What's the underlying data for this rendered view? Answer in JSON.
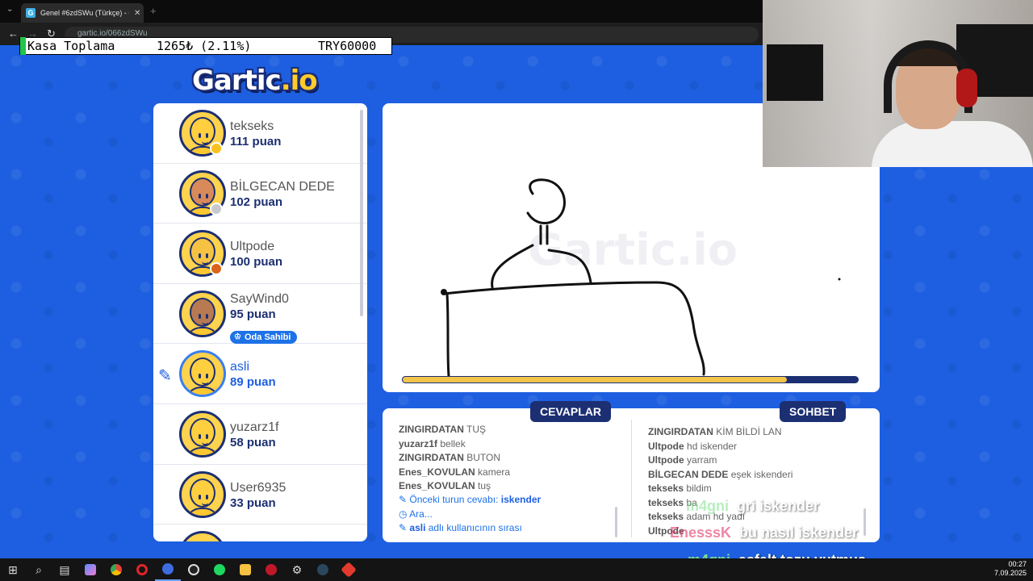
{
  "browser": {
    "tab_title": "Genel #6zdSWu (Türkçe) - Gartic",
    "tab_favicon": "G",
    "url": "gartic.io/066zdSWu"
  },
  "ticker": {
    "label": "Kasa Toplama",
    "amount": "1265₺ (2.11%)",
    "goal": "TRY60000"
  },
  "logo": {
    "main": "Gartic",
    "suffix": ".io"
  },
  "players": [
    {
      "name": "tekseks",
      "points": "111 puan",
      "dot": "#f7c21f",
      "skin": "#ffcf3f"
    },
    {
      "name": "BİLGECAN DEDE",
      "points": "102 puan",
      "dot": "#c7c9ce",
      "skin": "#d88a5a"
    },
    {
      "name": "Ultpode",
      "points": "100 puan",
      "dot": "#d9641a",
      "skin": "#f5c244"
    },
    {
      "name": "SayWind0",
      "points": "95 puan",
      "host": "Oda Sahibi",
      "skin": "#b87a52"
    },
    {
      "name": "asli",
      "points": "89 puan",
      "active": true,
      "skin": "#ffcf3f"
    },
    {
      "name": "yuzarz1f",
      "points": "58 puan",
      "skin": "#ffcf3f"
    },
    {
      "name": "User6935",
      "points": "33 puan",
      "skin": "#ffcf3f"
    }
  ],
  "canvas": {
    "watermark": "Gartic.io",
    "timer_fraction": 0.845
  },
  "tabs": {
    "answers": "CEVAPLAR",
    "chat": "SOHBET"
  },
  "answers": [
    {
      "user": "ZINGIRDATAN",
      "text": "TUŞ"
    },
    {
      "user": "yuzarz1f",
      "text": "bellek"
    },
    {
      "user": "ZINGIRDATAN",
      "text": "BUTON"
    },
    {
      "user": "Enes_KOVULAN",
      "text": "kamera"
    },
    {
      "user": "Enes_KOVULAN",
      "text": "tuş"
    }
  ],
  "answer_info": [
    {
      "icon": "pencil-icon",
      "prefix": "Önceki turun cevabı:",
      "value": "iskender"
    },
    {
      "icon": "clock-icon",
      "prefix": "Ara...",
      "value": ""
    },
    {
      "icon": "pencil-icon",
      "prefix": "adlı kullanıcının sırası",
      "value": "asli"
    }
  ],
  "chat": [
    {
      "user": "ZINGIRDATAN",
      "text": "KİM BİLDİ LAN"
    },
    {
      "user": "Ultpode",
      "text": "hd iskender"
    },
    {
      "user": "Ultpode",
      "text": "yarram"
    },
    {
      "user": "BİLGECAN DEDE",
      "text": "eşek iskenderi"
    },
    {
      "user": "tekseks",
      "text": "bildim"
    },
    {
      "user": "tekseks",
      "text": "ba"
    },
    {
      "user": "tekseks",
      "text": "adam hd yadı"
    },
    {
      "user": "Ultpode",
      "text": ""
    }
  ],
  "overlay_chat": [
    {
      "nick": "m4gni",
      "text": "gri iskender",
      "nick_color": "#7de08a",
      "faded": true
    },
    {
      "nick": "EnesssK",
      "text": "bu nasıl iskender",
      "nick_color": "#e0245e",
      "faded": true
    },
    {
      "nick": "m4gni",
      "text": "asfalt tozu yutmuş",
      "nick_color": "#7de08a",
      "faded": false
    }
  ],
  "clock": {
    "time": "00:27",
    "date": "7.09.2025"
  },
  "colors": {
    "accent": "#1d5fe0",
    "navy": "#1c2f72",
    "timer": "#f2c44a"
  }
}
